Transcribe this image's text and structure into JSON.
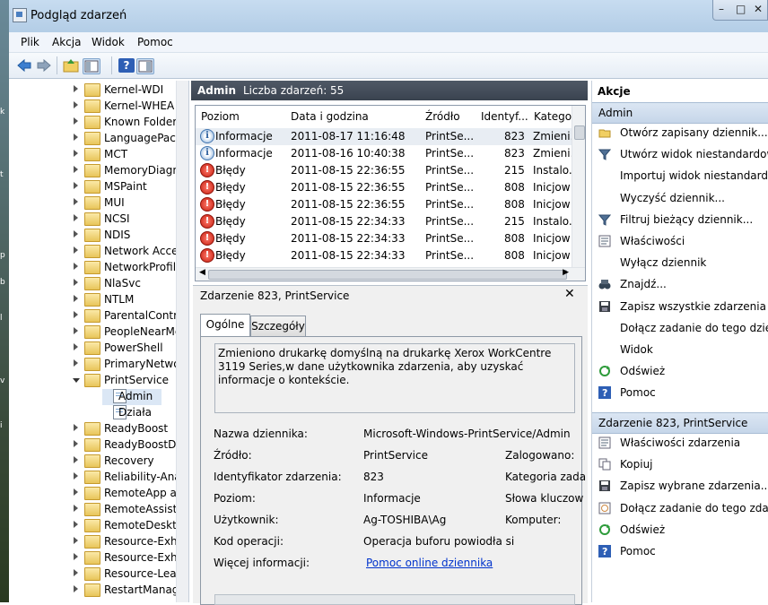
{
  "window": {
    "title": "Podgląd zdarzeń",
    "controls": [
      "–",
      "□",
      "✕"
    ]
  },
  "menu": [
    "Plik",
    "Akcja",
    "Widok",
    "Pomoc"
  ],
  "toolbar": {
    "icons": [
      "back-arrow-icon",
      "forward-arrow-icon",
      "up-folder-icon",
      "show-hide-tree-icon",
      "help-icon",
      "show-hide-action-pane-icon"
    ]
  },
  "tree": {
    "items": [
      {
        "label": "Kernel-WDI",
        "type": "folder",
        "expanded": false
      },
      {
        "label": "Kernel-WHEA",
        "type": "folder",
        "expanded": false
      },
      {
        "label": "Known Folders",
        "type": "folder",
        "expanded": false
      },
      {
        "label": "LanguagePack",
        "type": "folder",
        "expanded": false
      },
      {
        "label": "MCT",
        "type": "folder",
        "expanded": false
      },
      {
        "label": "MemoryDiagn",
        "type": "folder",
        "expanded": false
      },
      {
        "label": "MSPaint",
        "type": "folder",
        "expanded": false
      },
      {
        "label": "MUI",
        "type": "folder",
        "expanded": false
      },
      {
        "label": "NCSI",
        "type": "folder",
        "expanded": false
      },
      {
        "label": "NDIS",
        "type": "folder",
        "expanded": false
      },
      {
        "label": "Network Acces",
        "type": "folder",
        "expanded": false
      },
      {
        "label": "NetworkProfile",
        "type": "folder",
        "expanded": false
      },
      {
        "label": "NlaSvc",
        "type": "folder",
        "expanded": false
      },
      {
        "label": "NTLM",
        "type": "folder",
        "expanded": false
      },
      {
        "label": "ParentalContro",
        "type": "folder",
        "expanded": false
      },
      {
        "label": "PeopleNearMe",
        "type": "folder",
        "expanded": false
      },
      {
        "label": "PowerShell",
        "type": "folder",
        "expanded": false
      },
      {
        "label": "PrimaryNetwo",
        "type": "folder",
        "expanded": false
      },
      {
        "label": "PrintService",
        "type": "folder",
        "expanded": true
      },
      {
        "label": "Admin",
        "type": "log",
        "selected": true
      },
      {
        "label": "Działa",
        "type": "log"
      },
      {
        "label": "ReadyBoost",
        "type": "folder",
        "expanded": false
      },
      {
        "label": "ReadyBoostDri",
        "type": "folder",
        "expanded": false
      },
      {
        "label": "Recovery",
        "type": "folder",
        "expanded": false
      },
      {
        "label": "Reliability-Ana",
        "type": "folder",
        "expanded": false
      },
      {
        "label": "RemoteApp ar",
        "type": "folder",
        "expanded": false
      },
      {
        "label": "RemoteAssista",
        "type": "folder",
        "expanded": false
      },
      {
        "label": "RemoteDeskto",
        "type": "folder",
        "expanded": false
      },
      {
        "label": "Resource-Exha",
        "type": "folder",
        "expanded": false
      },
      {
        "label": "Resource-Exha",
        "type": "folder",
        "expanded": false
      },
      {
        "label": "Resource-Leak",
        "type": "folder",
        "expanded": false
      },
      {
        "label": "RestartManage",
        "type": "folder",
        "expanded": false
      }
    ]
  },
  "center": {
    "log_name": "Admin",
    "count_text": "Liczba zdarzeń: 55",
    "columns": [
      "Poziom",
      "Data i godzina",
      "Źródło",
      "Identyf...",
      "Katego..."
    ],
    "rows": [
      {
        "level": "Informacje",
        "icon": "info-icon",
        "date": "2011-08-17 11:16:48",
        "source": "PrintSe...",
        "id": "823",
        "category": "Zmieni..."
      },
      {
        "level": "Informacje",
        "icon": "info-icon",
        "date": "2011-08-16 10:40:38",
        "source": "PrintSe...",
        "id": "823",
        "category": "Zmieni..."
      },
      {
        "level": "Błędy",
        "icon": "error-icon",
        "date": "2011-08-15 22:36:55",
        "source": "PrintSe...",
        "id": "215",
        "category": "Instalo..."
      },
      {
        "level": "Błędy",
        "icon": "error-icon",
        "date": "2011-08-15 22:36:55",
        "source": "PrintSe...",
        "id": "808",
        "category": "Inicjow"
      },
      {
        "level": "Błędy",
        "icon": "error-icon",
        "date": "2011-08-15 22:36:55",
        "source": "PrintSe...",
        "id": "808",
        "category": "Inicjow"
      },
      {
        "level": "Błędy",
        "icon": "error-icon",
        "date": "2011-08-15 22:34:33",
        "source": "PrintSe...",
        "id": "215",
        "category": "Instalo..."
      },
      {
        "level": "Błędy",
        "icon": "error-icon",
        "date": "2011-08-15 22:34:33",
        "source": "PrintSe...",
        "id": "808",
        "category": "Inicjow"
      },
      {
        "level": "Błędy",
        "icon": "error-icon",
        "date": "2011-08-15 22:34:33",
        "source": "PrintSe...",
        "id": "808",
        "category": "Inicjow"
      }
    ]
  },
  "detail": {
    "title": "Zdarzenie 823, PrintService",
    "tabs": [
      "Ogólne",
      "Szczegóły"
    ],
    "description": "Zmieniono drukarkę domyślną na drukarkę Xerox WorkCentre 3119 Series,w dane użytkownika zdarzenia, aby uzyskać informacje o kontekście.",
    "fields": {
      "log_name_label": "Nazwa dziennika:",
      "log_name_value": "Microsoft-Windows-PrintService/Admin",
      "source_label": "Źródło:",
      "source_value": "PrintService",
      "logged_label": "Zalogowano:",
      "event_id_label": "Identyfikator zdarzenia:",
      "event_id_value": "823",
      "task_category_label": "Kategoria zada",
      "level_label": "Poziom:",
      "level_value": "Informacje",
      "keywords_label": "Słowa kluczow",
      "user_label": "Użytkownik:",
      "user_value": "Ag-TOSHIBA\\Ag",
      "computer_label": "Komputer:",
      "opcode_label": "Kod operacji:",
      "opcode_value": "Operacja buforu powiodła si",
      "more_info_label": "Więcej informacji:",
      "more_info_link": "Pomoc online dziennika"
    }
  },
  "actions": {
    "header": "Akcje",
    "section1": "Admin",
    "section1_items": [
      {
        "label": "Otwórz zapisany dziennik...",
        "icon": "open-folder-icon"
      },
      {
        "label": "Utwórz widok niestandardowy...",
        "icon": "filter-funnel-icon"
      },
      {
        "label": "Importuj widok niestandardowy...",
        "icon": ""
      },
      {
        "label": "Wyczyść dziennik...",
        "icon": ""
      },
      {
        "label": "Filtruj bieżący dziennik...",
        "icon": "filter-funnel-icon"
      },
      {
        "label": "Właściwości",
        "icon": "properties-icon"
      },
      {
        "label": "Wyłącz dziennik",
        "icon": ""
      },
      {
        "label": "Znajdź...",
        "icon": "binoculars-icon"
      },
      {
        "label": "Zapisz wszystkie zdarzenia jako...",
        "icon": "save-icon"
      },
      {
        "label": "Dołącz zadanie do tego dziennika",
        "icon": ""
      },
      {
        "label": "Widok",
        "icon": ""
      },
      {
        "label": "Odśwież",
        "icon": "refresh-icon"
      },
      {
        "label": "Pomoc",
        "icon": "help-icon"
      }
    ],
    "section2": "Zdarzenie 823, PrintService",
    "section2_items": [
      {
        "label": "Właściwości zdarzenia",
        "icon": "properties-icon"
      },
      {
        "label": "Kopiuj",
        "icon": "copy-icon"
      },
      {
        "label": "Zapisz wybrane zdarzenia...",
        "icon": "save-icon"
      },
      {
        "label": "Dołącz zadanie do tego zdarzenia",
        "icon": "task-icon"
      },
      {
        "label": "Odśwież",
        "icon": "refresh-icon"
      },
      {
        "label": "Pomoc",
        "icon": "help-icon"
      }
    ]
  },
  "colors": {
    "title_bar": "#bcd3ea",
    "section_header": "#cfdcec",
    "center_header": "#434c58",
    "link": "#0033cc"
  }
}
